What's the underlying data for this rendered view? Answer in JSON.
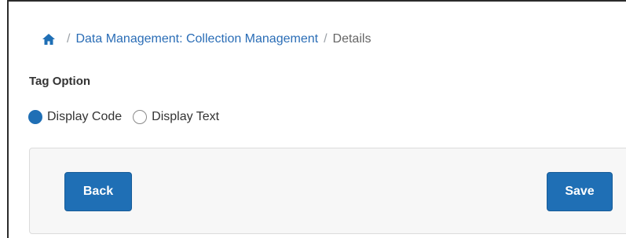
{
  "breadcrumb": {
    "home_icon": "home-icon",
    "separator": "/",
    "link_label": "Data Management: Collection Management",
    "current_label": "Details"
  },
  "tag_option": {
    "label": "Tag Option",
    "options": [
      {
        "label": "Display Code",
        "checked": true
      },
      {
        "label": "Display Text",
        "checked": false
      }
    ]
  },
  "actions": {
    "back_label": "Back",
    "save_label": "Save"
  },
  "colors": {
    "accent": "#1f6fb5",
    "link": "#2a6db6"
  }
}
